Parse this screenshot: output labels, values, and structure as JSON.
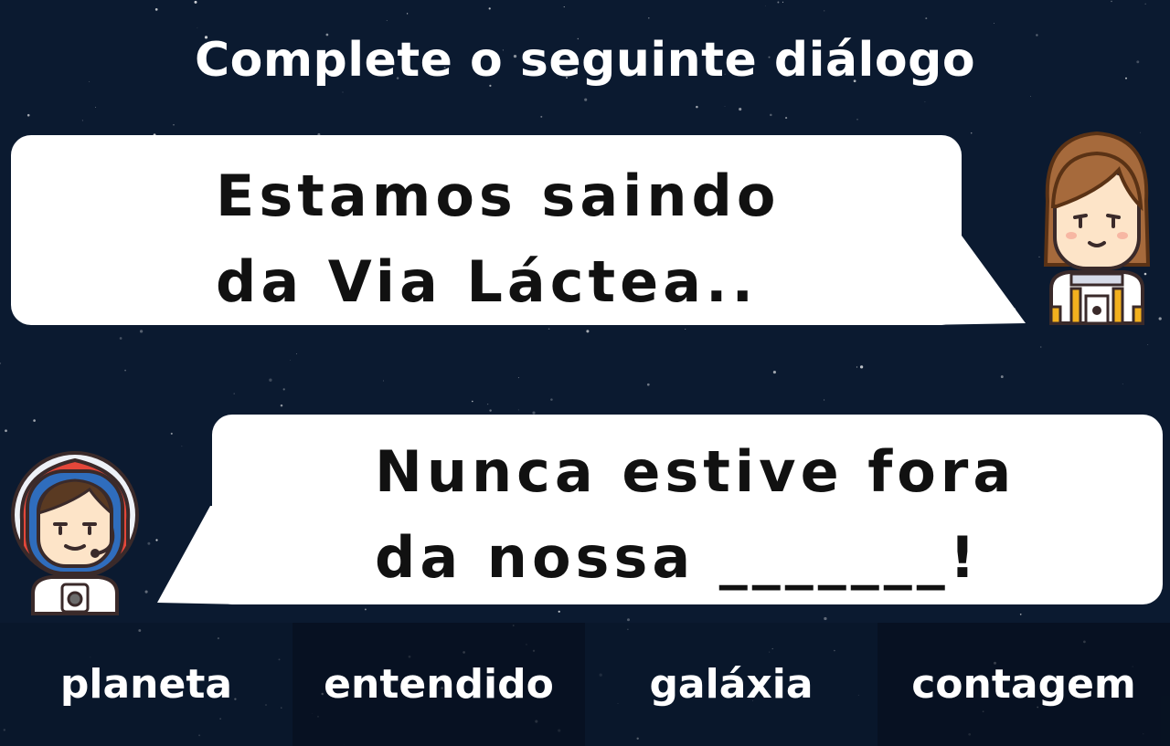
{
  "title": "Complete o seguinte diálogo",
  "dialogue": [
    {
      "speaker_icon": "astronaut-woman-icon",
      "lines": "Estamos saindo\nda Via Láctea.."
    },
    {
      "speaker_icon": "astronaut-man-icon",
      "lines": "Nunca estive fora\nda nossa _______!"
    }
  ],
  "options": [
    "planeta",
    "entendido",
    "galáxia",
    "contagem"
  ],
  "colors": {
    "background": "#0b1a30",
    "bubble": "#ffffff",
    "text": "#111111",
    "option_text": "#ffffff"
  }
}
